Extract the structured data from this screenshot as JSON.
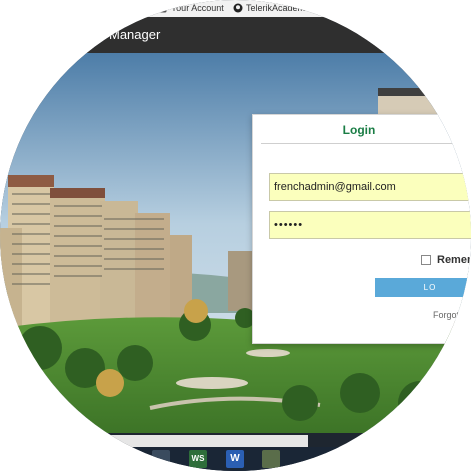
{
  "bookmarks": {
    "your_account": "Your Account",
    "telerik": "TelerikAcadem"
  },
  "navbar": {
    "brand": "Manager"
  },
  "login": {
    "title": "Login",
    "email_value": "frenchadmin@gmail.com",
    "password_value": "••••••",
    "remember_label": "Remem",
    "button_label": "LO",
    "forgot_label": "Forgot"
  },
  "taskbar": {
    "ws_label": "WS",
    "word_label": "W"
  },
  "colors": {
    "accent_green": "#1a7d45",
    "field_yellow": "#fbffbd",
    "button_blue": "#5aa9d9",
    "navbar": "#2f2f2f"
  },
  "icons": [
    "account-icon",
    "github-icon",
    "checkbox-icon",
    "ws-app-icon",
    "word-icon",
    "settings-app-icon"
  ]
}
